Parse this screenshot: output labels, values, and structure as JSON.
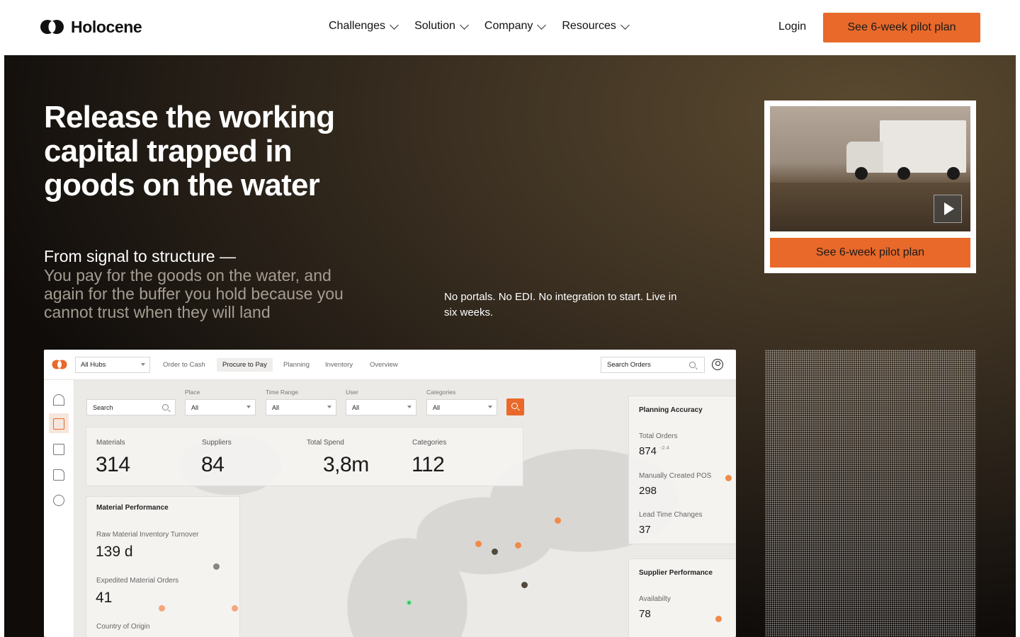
{
  "brand": {
    "name": "Holocene",
    "accent": "#e8692a"
  },
  "nav": {
    "items": [
      {
        "label": "Challenges"
      },
      {
        "label": "Solution"
      },
      {
        "label": "Company"
      },
      {
        "label": "Resources"
      }
    ],
    "login": "Login",
    "cta": "See 6-week pilot plan"
  },
  "hero": {
    "title": "Release the working capital trapped in goods on the water",
    "sub_head": "From signal to structure —",
    "sub_body": "You pay for the goods on the water, and again for the buffer you hold because you cannot trust when they will land",
    "note": "No portals. No EDI. No integration to start. Live in six weeks.",
    "video_cta": "See 6-week pilot plan"
  },
  "dashboard": {
    "hub_select": "All Hubs",
    "tabs": [
      {
        "label": "Order to Cash",
        "active": false
      },
      {
        "label": "Procure to Pay",
        "active": true
      },
      {
        "label": "Planning",
        "active": false
      },
      {
        "label": "Inventory",
        "active": false
      },
      {
        "label": "Overview",
        "active": false
      }
    ],
    "search_orders": "Search Orders",
    "filters": {
      "search": "Search",
      "place": {
        "label": "Place",
        "value": "All"
      },
      "time_range": {
        "label": "Time Range",
        "value": "All"
      },
      "user": {
        "label": "User",
        "value": "All"
      },
      "categories": {
        "label": "Categories",
        "value": "All"
      }
    },
    "kpis": [
      {
        "label": "Materials",
        "value": "314"
      },
      {
        "label": "Suppliers",
        "value": "84"
      },
      {
        "label": "Total Spend",
        "value": "3,8m"
      },
      {
        "label": "Categories",
        "value": "112"
      }
    ],
    "material_performance": {
      "title": "Material Performance",
      "items": [
        {
          "label": "Raw Material Inventory Turnover",
          "value": "139 d"
        },
        {
          "label": "Expedited Material Orders",
          "value": "41"
        },
        {
          "label": "Country of Origin",
          "value": ""
        }
      ]
    },
    "planning_accuracy": {
      "title": "Planning Accuracy",
      "items": [
        {
          "label": "Total Orders",
          "value": "874",
          "delta": "-2.4"
        },
        {
          "label": "Manually Created POS",
          "value": "298"
        },
        {
          "label": "Lead Time Changes",
          "value": "37"
        }
      ]
    },
    "supplier_performance": {
      "title": "Supplier Performance",
      "items": [
        {
          "label": "Availabilty",
          "value": "78"
        }
      ]
    }
  }
}
